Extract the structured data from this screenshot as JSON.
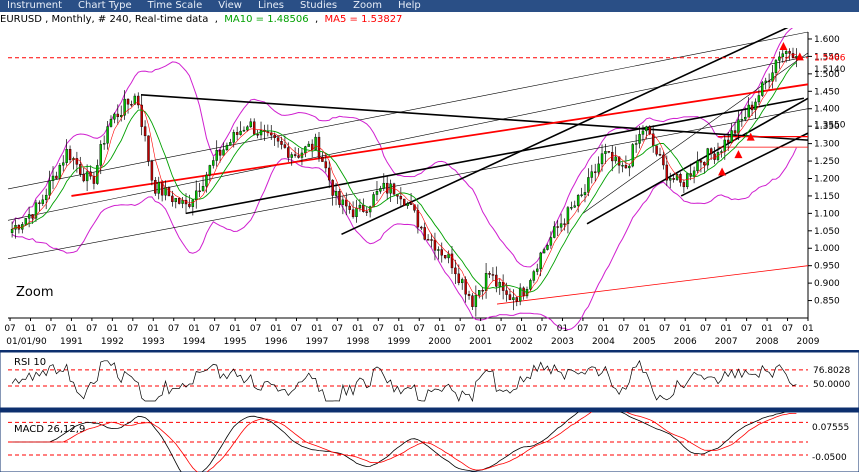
{
  "menu": [
    "Instrument",
    "Chart Type",
    "Time Scale",
    "View",
    "Lines",
    "Studies",
    "Zoom",
    "Help"
  ],
  "header": {
    "symbol_info": "EURUSD , Monthly, # 240, Real-time data",
    "ma10_label": "MA10 = 1.48506",
    "ma5_label": "MA5 = 1.53827",
    "ma10_color": "#00a000",
    "ma5_color": "#ff0000"
  },
  "zoom_label": "Zoom",
  "chart_data": [
    {
      "type": "candlestick",
      "ylim": [
        0.8,
        1.62
      ],
      "y_ticks": [
        "1.600",
        "1.550",
        "1.500",
        "1.450",
        "1.400",
        "1.350",
        "1.300",
        "1.250",
        "1.200",
        "1.150",
        "1.100",
        "1.050",
        "1.000",
        "0.950",
        "0.900",
        "0.850"
      ],
      "last_price_labels": [
        "1.5466",
        "1.5140",
        "1.3550"
      ],
      "x_month_labels": [
        "07",
        "01",
        "07",
        "01",
        "07",
        "01",
        "07",
        "01",
        "07",
        "01",
        "07",
        "01",
        "07",
        "01",
        "07",
        "01",
        "07",
        "01",
        "07",
        "01",
        "07",
        "01",
        "07",
        "01",
        "07",
        "01",
        "07",
        "01",
        "07",
        "01",
        "07",
        "01",
        "07",
        "01",
        "07",
        "01",
        "07",
        "01",
        "07",
        "01"
      ],
      "x_year_labels": [
        "01/01/90",
        "1991",
        "1992",
        "1993",
        "1994",
        "1995",
        "1996",
        "1997",
        "1998",
        "1999",
        "2000",
        "2001",
        "2002",
        "2003",
        "2004",
        "2005",
        "2006",
        "2007",
        "2008",
        "2009"
      ],
      "price_path": [
        [
          1989.5,
          1.05
        ],
        [
          1990.2,
          1.12
        ],
        [
          1990.9,
          1.28
        ],
        [
          1991.5,
          1.18
        ],
        [
          1991.9,
          1.36
        ],
        [
          1992.6,
          1.44
        ],
        [
          1993.0,
          1.18
        ],
        [
          1993.8,
          1.12
        ],
        [
          1994.6,
          1.27
        ],
        [
          1995.3,
          1.36
        ],
        [
          1995.8,
          1.31
        ],
        [
          1996.5,
          1.27
        ],
        [
          1997.0,
          1.3
        ],
        [
          1997.5,
          1.13
        ],
        [
          1998.0,
          1.1
        ],
        [
          1998.6,
          1.17
        ],
        [
          1999.0,
          1.17
        ],
        [
          1999.6,
          1.05
        ],
        [
          2000.3,
          0.96
        ],
        [
          2000.8,
          0.85
        ],
        [
          2001.2,
          0.93
        ],
        [
          2001.6,
          0.86
        ],
        [
          2002.0,
          0.87
        ],
        [
          2002.5,
          0.99
        ],
        [
          2003.0,
          1.08
        ],
        [
          2003.5,
          1.15
        ],
        [
          2004.0,
          1.27
        ],
        [
          2004.5,
          1.22
        ],
        [
          2005.0,
          1.35
        ],
        [
          2005.5,
          1.22
        ],
        [
          2005.9,
          1.18
        ],
        [
          2006.3,
          1.25
        ],
        [
          2006.8,
          1.28
        ],
        [
          2007.3,
          1.35
        ],
        [
          2007.9,
          1.46
        ],
        [
          2008.3,
          1.56
        ],
        [
          2008.7,
          1.57
        ]
      ],
      "ma_fast": {
        "name": "MA5",
        "color": "#ff0000"
      },
      "ma_slow": {
        "name": "MA10",
        "color": "#00a000"
      }
    },
    {
      "type": "line",
      "title": "RSI 10",
      "ylim": [
        20,
        100
      ],
      "levels": [
        76.8028,
        50.0
      ],
      "level_labels": [
        "76.8028",
        "50.0000"
      ]
    },
    {
      "type": "line",
      "title": "MACD 26,12,9",
      "ylim": [
        -0.08,
        0.1
      ],
      "levels": [
        0.07555,
        0.0,
        -0.05
      ],
      "level_labels": [
        "0.07555",
        "-0.0500"
      ]
    }
  ]
}
